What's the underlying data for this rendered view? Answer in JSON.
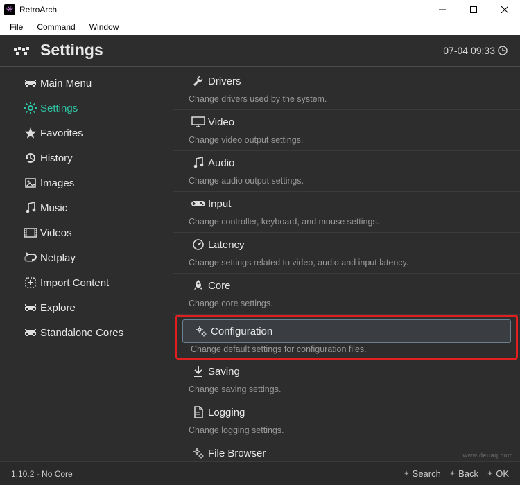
{
  "window": {
    "title": "RetroArch",
    "menubar": [
      "File",
      "Command",
      "Window"
    ]
  },
  "header": {
    "title": "Settings",
    "clock": "07-04 09:33"
  },
  "sidebar": {
    "items": [
      {
        "label": "Main Menu",
        "icon": "invader"
      },
      {
        "label": "Settings",
        "icon": "gear",
        "active": true
      },
      {
        "label": "Favorites",
        "icon": "star"
      },
      {
        "label": "History",
        "icon": "history"
      },
      {
        "label": "Images",
        "icon": "image"
      },
      {
        "label": "Music",
        "icon": "music"
      },
      {
        "label": "Videos",
        "icon": "video"
      },
      {
        "label": "Netplay",
        "icon": "netplay"
      },
      {
        "label": "Import Content",
        "icon": "plus"
      },
      {
        "label": "Explore",
        "icon": "invader"
      },
      {
        "label": "Standalone Cores",
        "icon": "invader"
      }
    ]
  },
  "settings": [
    {
      "icon": "wrench",
      "label": "Drivers",
      "desc": "Change drivers used by the system."
    },
    {
      "icon": "monitor",
      "label": "Video",
      "desc": "Change video output settings."
    },
    {
      "icon": "music",
      "label": "Audio",
      "desc": "Change audio output settings."
    },
    {
      "icon": "gamepad",
      "label": "Input",
      "desc": "Change controller, keyboard, and mouse settings."
    },
    {
      "icon": "latency",
      "label": "Latency",
      "desc": "Change settings related to video, audio and input latency."
    },
    {
      "icon": "rocket",
      "label": "Core",
      "desc": "Change core settings."
    },
    {
      "icon": "cogs",
      "label": "Configuration",
      "desc": "Change default settings for configuration files.",
      "highlight": true
    },
    {
      "icon": "download",
      "label": "Saving",
      "desc": "Change saving settings."
    },
    {
      "icon": "file",
      "label": "Logging",
      "desc": "Change logging settings."
    },
    {
      "icon": "cogs",
      "label": "File Browser",
      "desc": ""
    }
  ],
  "footer": {
    "status": "1.10.2 - No Core",
    "hints": [
      {
        "label": "Search"
      },
      {
        "label": "Back"
      },
      {
        "label": "OK"
      }
    ]
  },
  "watermark": "www.deuaq.com"
}
